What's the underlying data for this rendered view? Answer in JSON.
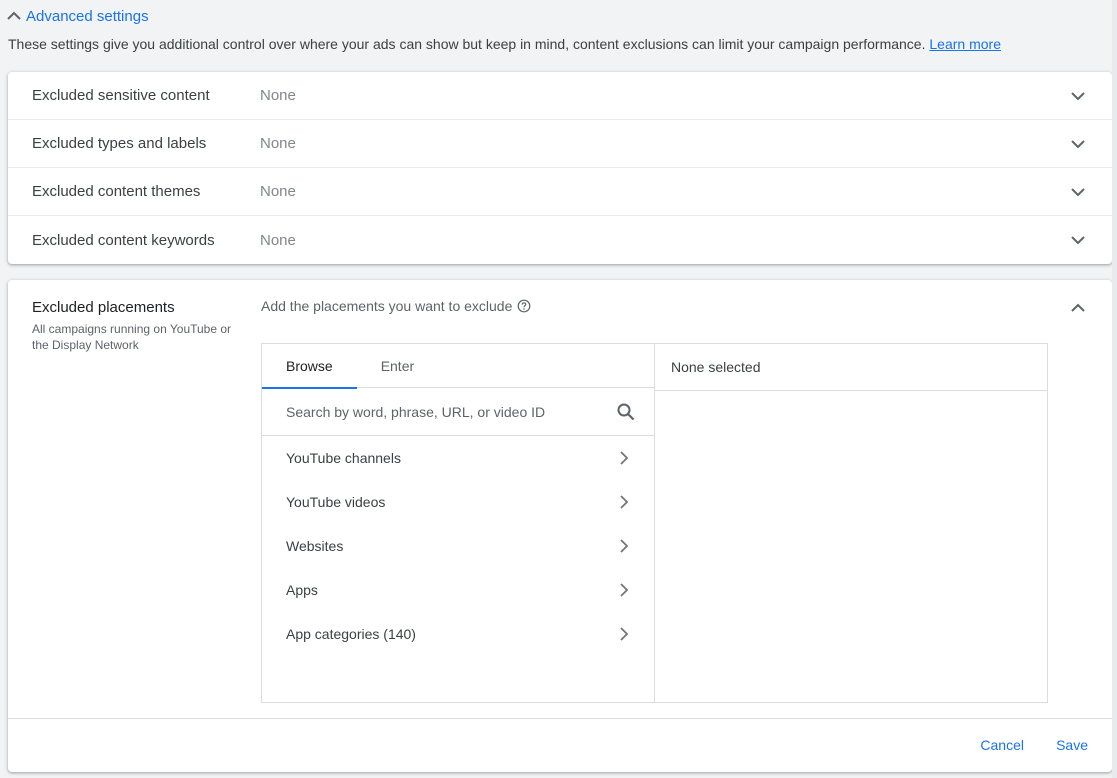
{
  "advanced": {
    "title": "Advanced settings",
    "description": "These settings give you additional control over where your ads can show but keep in mind, content exclusions can limit your campaign performance.",
    "learn_more": "Learn more"
  },
  "exclusions": [
    {
      "label": "Excluded sensitive content",
      "value": "None"
    },
    {
      "label": "Excluded types and labels",
      "value": "None"
    },
    {
      "label": "Excluded content themes",
      "value": "None"
    },
    {
      "label": "Excluded content keywords",
      "value": "None"
    }
  ],
  "placements": {
    "title": "Excluded placements",
    "subtitle": "All campaigns running on YouTube or the Display Network",
    "prompt": "Add the placements you want to exclude",
    "tabs": [
      {
        "label": "Browse",
        "active": true
      },
      {
        "label": "Enter",
        "active": false
      }
    ],
    "search_placeholder": "Search by word, phrase, URL, or video ID",
    "categories": [
      {
        "label": "YouTube channels"
      },
      {
        "label": "YouTube videos"
      },
      {
        "label": "Websites"
      },
      {
        "label": "Apps"
      },
      {
        "label": "App categories (140)"
      }
    ],
    "selected_header": "None selected",
    "cancel_label": "Cancel",
    "save_label": "Save"
  },
  "colors": {
    "accent": "#1a73e8",
    "background": "#f1f3f4",
    "text": "#3c4043",
    "muted": "#80868b"
  }
}
